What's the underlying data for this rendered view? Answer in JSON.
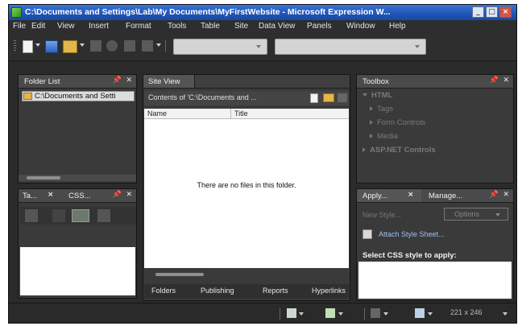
{
  "window": {
    "title": "C:\\Documents and Settings\\Lab\\My Documents\\MyFirstWebsite - Microsoft Expression W...",
    "controls": {
      "minimize": "_",
      "maximize": "□",
      "close": "×"
    }
  },
  "menu": [
    "File",
    "Edit",
    "View",
    "Insert",
    "Format",
    "Tools",
    "Table",
    "Site",
    "Data View",
    "Panels",
    "Window",
    "Help"
  ],
  "folder_list": {
    "title": "Folder List",
    "item": "C:\\Documents and Setti"
  },
  "tag_css_panel": {
    "tab1": "Ta...",
    "tab2": "CSS..."
  },
  "site_view": {
    "tab": "Site View",
    "contents_label": "Contents of 'C:\\Documents and ...",
    "columns": [
      "Name",
      "Title"
    ],
    "empty_message": "There are no files in this folder.",
    "bottom_tabs": [
      "Folders",
      "Publishing",
      "Reports",
      "Hyperlinks"
    ]
  },
  "toolbox": {
    "title": "Toolbox",
    "root": "HTML",
    "items": [
      "Tags",
      "Form Controls",
      "Media"
    ],
    "aspnet": "ASP.NET Controls"
  },
  "apply_styles": {
    "tab1": "Apply...",
    "tab2": "Manage...",
    "new_style": "New Style...",
    "options": "Options",
    "attach": "Attach Style Sheet...",
    "select_label": "Select CSS style to apply:"
  },
  "status": {
    "dimensions": "221 x 246"
  },
  "icons": [
    "app-icon",
    "new-page-icon",
    "save-icon",
    "open-folder-icon",
    "pin-icon",
    "close-icon",
    "folder-icon"
  ]
}
